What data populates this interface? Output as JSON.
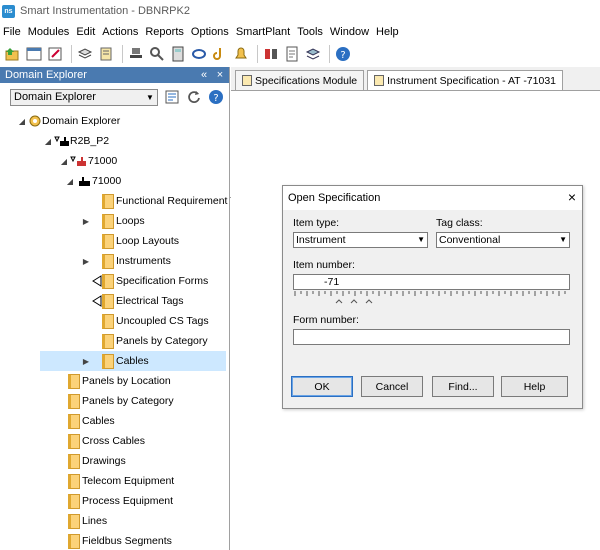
{
  "window": {
    "app_icon_text": "ns",
    "title": "Smart Instrumentation - DBNRPK2"
  },
  "menu": [
    "File",
    "Modules",
    "Edit",
    "Actions",
    "Reports",
    "Options",
    "SmartPlant",
    "Tools",
    "Window",
    "Help"
  ],
  "left_panel": {
    "title": "Domain Explorer",
    "header_buttons": [
      "«",
      "×"
    ],
    "combo_value": "Domain Explorer",
    "tree": [
      {
        "label": "Domain Explorer"
      },
      {
        "label": "R2B_P2"
      },
      {
        "label": "71000"
      },
      {
        "label": "71000"
      },
      {
        "label": "Functional Requirement Ta"
      },
      {
        "label": "Loops"
      },
      {
        "label": "Loop Layouts"
      },
      {
        "label": "Instruments"
      },
      {
        "label": "Specification Forms"
      },
      {
        "label": "Electrical Tags"
      },
      {
        "label": "Uncoupled CS Tags"
      },
      {
        "label": "Panels by Category"
      },
      {
        "label": "Cables"
      },
      {
        "label": "Panels by Location"
      },
      {
        "label": "Panels by Category"
      },
      {
        "label": "Cables"
      },
      {
        "label": "Cross Cables"
      },
      {
        "label": "Drawings"
      },
      {
        "label": "Telecom Equipment"
      },
      {
        "label": "Process Equipment"
      },
      {
        "label": "Lines"
      },
      {
        "label": "Fieldbus Segments"
      }
    ]
  },
  "tabs": [
    {
      "label": "Specifications Module"
    },
    {
      "label": "Instrument Specification - AT   -71031"
    }
  ],
  "dialog": {
    "title": "Open Specification",
    "close": "×",
    "item_type_label": "Item type:",
    "item_type_value": "Instrument",
    "tag_class_label": "Tag class:",
    "tag_class_value": "Conventional",
    "item_number_label": "Item number:",
    "item_number_value": "-71",
    "form_number_label": "Form number:",
    "form_number_value": "",
    "buttons": {
      "ok": "OK",
      "cancel": "Cancel",
      "find": "Find...",
      "help": "Help"
    }
  }
}
